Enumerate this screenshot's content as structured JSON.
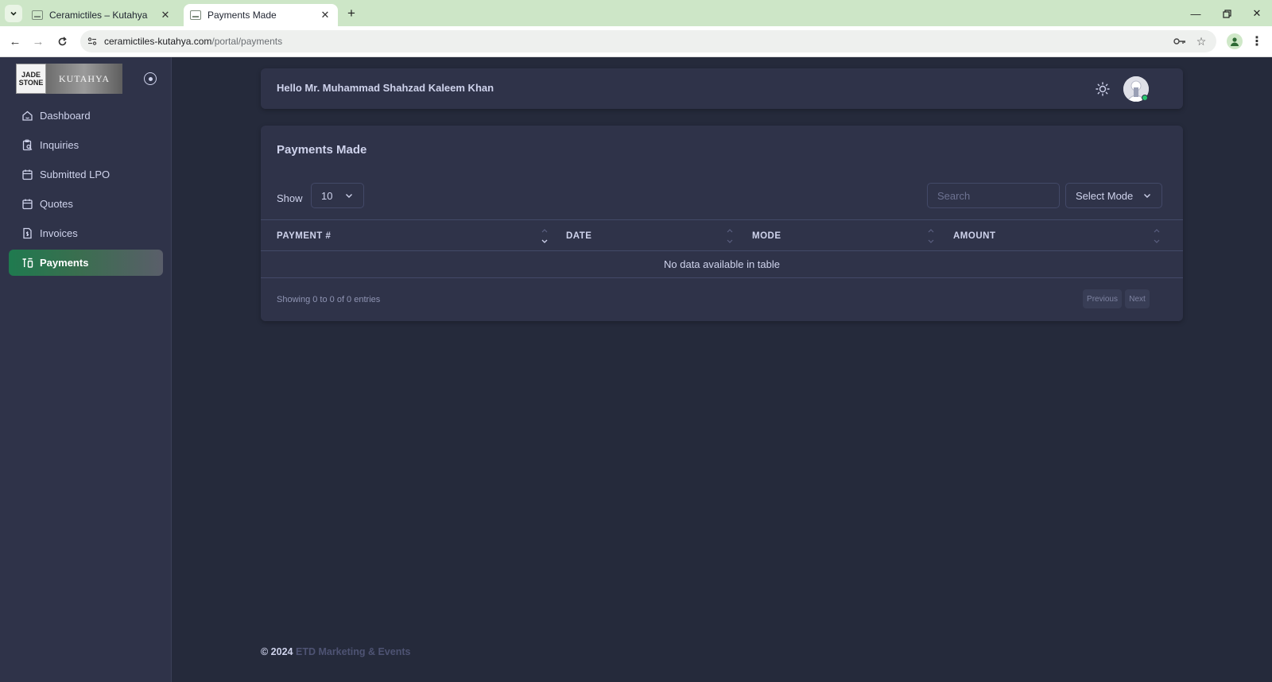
{
  "browser": {
    "tabs": [
      {
        "title": "Ceramictiles – Kutahya",
        "active": false
      },
      {
        "title": "Payments Made",
        "active": true
      }
    ],
    "url_host": "ceramictiles-kutahya.com",
    "url_path": "/portal/payments"
  },
  "logo": {
    "left_line1": "JADE",
    "left_line2": "STONE",
    "right_text": "KUTAHYA"
  },
  "sidebar": {
    "items": [
      {
        "label": "Dashboard",
        "icon": "home-icon",
        "active": false
      },
      {
        "label": "Inquiries",
        "icon": "clipboard-search-icon",
        "active": false
      },
      {
        "label": "Submitted LPO",
        "icon": "calendar-icon",
        "active": false
      },
      {
        "label": "Quotes",
        "icon": "calendar-icon",
        "active": false
      },
      {
        "label": "Invoices",
        "icon": "receipt-icon",
        "active": false
      },
      {
        "label": "Payments",
        "icon": "payments-icon",
        "active": true
      }
    ]
  },
  "header": {
    "greeting": "Hello Mr. Muhammad Shahzad Kaleem Khan"
  },
  "card": {
    "title": "Payments Made",
    "show_label": "Show",
    "page_length": "10",
    "search_placeholder": "Search",
    "mode_select": "Select Mode",
    "columns": [
      "PAYMENT #",
      "DATE",
      "MODE",
      "AMOUNT"
    ],
    "empty_message": "No data available in table",
    "info": "Showing 0 to 0 of 0 entries",
    "prev_label": "Previous",
    "next_label": "Next"
  },
  "footer": {
    "copyright": "© 2024",
    "brand": "ETD Marketing & Events"
  },
  "colors": {
    "accent": "#28c76f",
    "sidebar_bg": "#2f3349",
    "page_bg": "#252a3b",
    "tabbar_bg": "#cde6c7"
  }
}
